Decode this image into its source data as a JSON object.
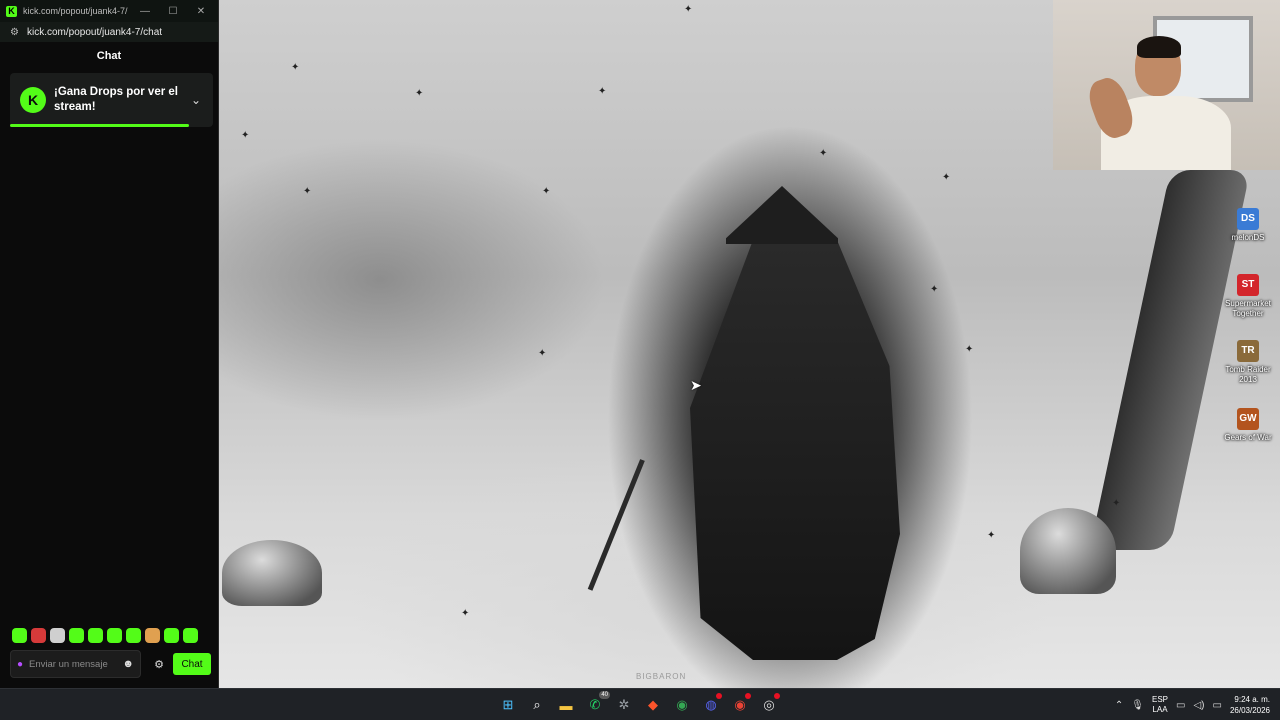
{
  "chat_window": {
    "title": "kick.com/popout/juank4-7/...",
    "url": "kick.com/popout/juank4-7/chat",
    "header": "Chat",
    "drops_card": {
      "text": "¡Gana Drops por ver el stream!",
      "logo_letter": "K",
      "progress_fraction": 0.88
    },
    "input": {
      "placeholder": "Enviar un mensaje"
    },
    "send_button": "Chat",
    "emotes": [
      "emote-1",
      "emote-2",
      "emote-3",
      "emote-4",
      "emote-5",
      "emote-6",
      "emote-7",
      "emote-8",
      "emote-9",
      "emote-10"
    ],
    "accent_color": "#53fc18"
  },
  "desktop_icons": [
    {
      "label": "melonDS",
      "glyph": "DS",
      "color": "#3a7bd5"
    },
    {
      "label": "Supermarket Together",
      "glyph": "ST",
      "color": "#d3252b"
    },
    {
      "label": "Tomb Raider 2013",
      "glyph": "TR",
      "color": "#8a6a3a"
    },
    {
      "label": "Gears of War",
      "glyph": "GW",
      "color": "#b3541e"
    }
  ],
  "wallpaper": {
    "watermark": "BIGBARON"
  },
  "taskbar": {
    "apps": [
      {
        "name": "start-icon",
        "glyph": "⊞",
        "color": "#4cc2ff"
      },
      {
        "name": "search-icon",
        "glyph": "⌕",
        "color": "#ffffff"
      },
      {
        "name": "file-explorer-icon",
        "glyph": "▬",
        "color": "#f5c542"
      },
      {
        "name": "whatsapp-icon",
        "glyph": "✆",
        "color": "#25d366",
        "badge": "40"
      },
      {
        "name": "settings-app-icon",
        "glyph": "✲",
        "color": "#9aa0a6"
      },
      {
        "name": "brave-icon",
        "glyph": "◆",
        "color": "#fb542b"
      },
      {
        "name": "chrome-icon",
        "glyph": "◉",
        "color": "#34a853"
      },
      {
        "name": "discord-icon",
        "glyph": "◍",
        "color": "#5865f2",
        "dot": true
      },
      {
        "name": "chrome-profile-icon",
        "glyph": "◉",
        "color": "#ea4335",
        "dot": true
      },
      {
        "name": "obs-icon",
        "glyph": "◎",
        "color": "#dddddd",
        "dot": true
      }
    ],
    "language": {
      "line1": "ESP",
      "line2": "LAA"
    },
    "clock": {
      "time": "9:24 a. m.",
      "date": "26/03/2026"
    }
  }
}
